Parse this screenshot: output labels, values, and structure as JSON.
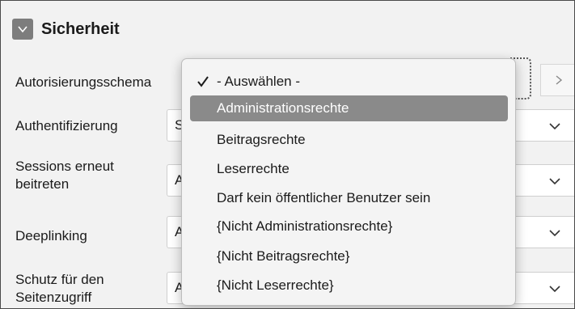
{
  "section": {
    "title": "Sicherheit"
  },
  "rows": [
    {
      "label": "Autorisierungsschema"
    },
    {
      "label": "Authentifizierung",
      "value": "S"
    },
    {
      "label_line1": "Sessions erneut",
      "label_line2": "beitreten",
      "value": "A"
    },
    {
      "label": "Deeplinking",
      "value": "A"
    },
    {
      "label_line1": "Schutz für den",
      "label_line2": "Seitenzugriff",
      "value": "A"
    }
  ],
  "dropdown": {
    "options": [
      {
        "label": "- Auswählen -",
        "selected": true
      },
      {
        "label": "Administrationsrechte",
        "highlighted": true
      },
      {
        "label": "Beitragsrechte"
      },
      {
        "label": "Leserrechte"
      },
      {
        "label": "Darf kein öffentlicher Benutzer sein"
      },
      {
        "label": "{Nicht Administrationsrechte}"
      },
      {
        "label": "{Nicht Beitragsrechte}"
      },
      {
        "label": "{Nicht Leserrechte}"
      }
    ]
  },
  "icons": {
    "collapse": "chevron-down-icon",
    "lov": "chevron-right-icon",
    "select": "chevron-down-icon",
    "selected": "checkmark-icon"
  },
  "colors": {
    "highlight": "#8a8a8a",
    "collapse_button": "#7d7d7d"
  }
}
